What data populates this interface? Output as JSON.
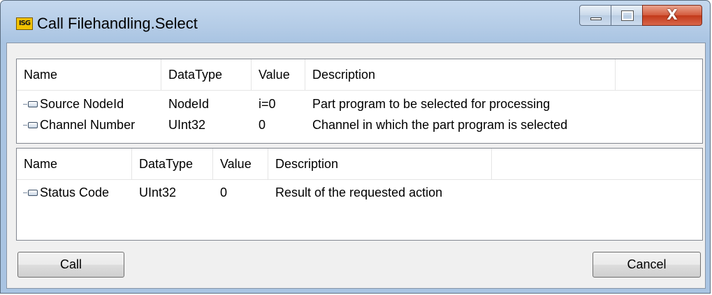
{
  "window": {
    "title": "Call Filehandling.Select",
    "icon": "app-logo-icon",
    "close_glyph": "X"
  },
  "input_table": {
    "columns": [
      "Name",
      "DataType",
      "Value",
      "Description"
    ],
    "rows": [
      {
        "name": "Source NodeId",
        "datatype": "NodeId",
        "value": "i=0",
        "description": "Part program to be selected for processing"
      },
      {
        "name": "Channel Number",
        "datatype": "UInt32",
        "value": "0",
        "description": "Channel in which the part program is selected"
      }
    ]
  },
  "output_table": {
    "columns": [
      "Name",
      "DataType",
      "Value",
      "Description"
    ],
    "rows": [
      {
        "name": "Status Code",
        "datatype": "UInt32",
        "value": "0",
        "description": "Result of the requested action"
      }
    ]
  },
  "buttons": {
    "call": "Call",
    "cancel": "Cancel"
  }
}
